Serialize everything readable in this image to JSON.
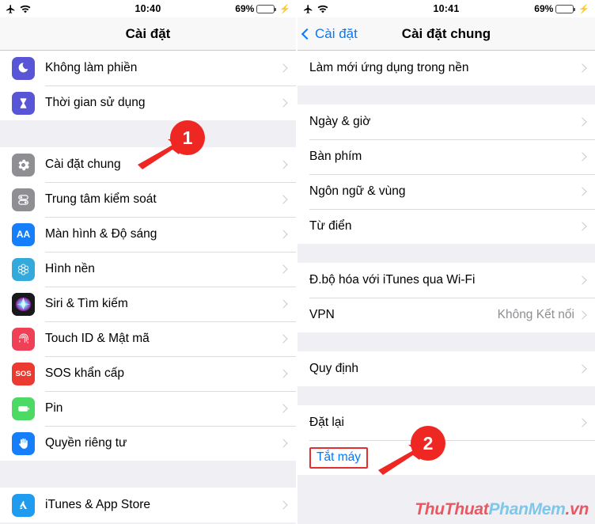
{
  "left": {
    "status": {
      "airplane_icon": "airplane-icon",
      "wifi_icon": "wifi-icon",
      "time": "10:40",
      "battery_percent": "69%",
      "battery_level": 69,
      "charging_icon": "lightning-bolt-icon"
    },
    "nav": {
      "title": "Cài đặt"
    },
    "groups": [
      {
        "items": [
          {
            "label": "Không làm phiền",
            "icon": "moon-icon",
            "icon_color": "#5856d6"
          },
          {
            "label": "Thời gian sử dụng",
            "icon": "hourglass-icon",
            "icon_color": "#5856d6"
          }
        ]
      },
      {
        "items": [
          {
            "label": "Cài đặt chung",
            "icon": "gear-icon",
            "icon_color": "#8e8e93"
          },
          {
            "label": "Trung tâm kiểm soát",
            "icon": "toggles-icon",
            "icon_color": "#8e8e93"
          },
          {
            "label": "Màn hình & Độ sáng",
            "icon": "text-size-icon",
            "icon_color": "#147efb"
          },
          {
            "label": "Hình nền",
            "icon": "wallpaper-icon",
            "icon_color": "#34aadc"
          },
          {
            "label": "Siri & Tìm kiếm",
            "icon": "siri-icon",
            "icon_color": "#1c1c1e"
          },
          {
            "label": "Touch ID & Mật mã",
            "icon": "fingerprint-icon",
            "icon_color": "#ef4056"
          },
          {
            "label": "SOS khẩn cấp",
            "icon": "sos-icon",
            "icon_color": "#eb3b30"
          },
          {
            "label": "Pin",
            "icon": "battery-icon",
            "icon_color": "#4cd964"
          },
          {
            "label": "Quyền riêng tư",
            "icon": "hand-icon",
            "icon_color": "#147efb"
          }
        ]
      },
      {
        "items": [
          {
            "label": "iTunes & App Store",
            "icon": "appstore-icon",
            "icon_color": "#1f9cf0"
          }
        ]
      }
    ],
    "annotation": {
      "number": "1"
    }
  },
  "right": {
    "status": {
      "airplane_icon": "airplane-icon",
      "wifi_icon": "wifi-icon",
      "time": "10:41",
      "battery_percent": "69%",
      "battery_level": 69,
      "charging_icon": "lightning-bolt-icon"
    },
    "nav": {
      "back_label": "Cài đặt",
      "title": "Cài đặt chung"
    },
    "groups": [
      {
        "items": [
          {
            "label": "Làm mới ứng dụng trong nền"
          }
        ]
      },
      {
        "items": [
          {
            "label": "Ngày & giờ"
          },
          {
            "label": "Bàn phím"
          },
          {
            "label": "Ngôn ngữ & vùng"
          },
          {
            "label": "Từ điển"
          }
        ]
      },
      {
        "items": [
          {
            "label": "Đ.bộ hóa với iTunes qua Wi-Fi"
          },
          {
            "label": "VPN",
            "value": "Không Kết nối"
          }
        ]
      },
      {
        "items": [
          {
            "label": "Quy định"
          }
        ]
      },
      {
        "items": [
          {
            "label": "Đặt lại"
          },
          {
            "label": "Tắt máy",
            "link": true,
            "highlighted": true
          }
        ]
      }
    ],
    "annotation": {
      "number": "2"
    },
    "watermark": {
      "part1": "ThuThuat",
      "part2": "PhanMem",
      "part3": ".vn"
    }
  }
}
